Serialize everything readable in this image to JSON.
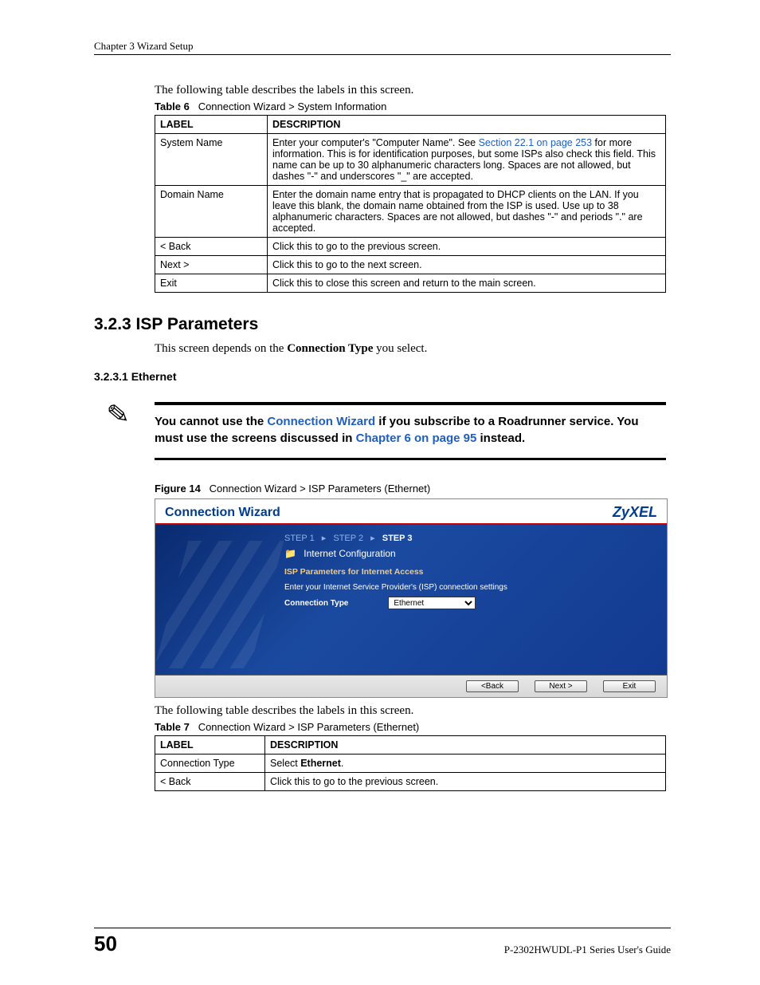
{
  "running_head": "Chapter 3 Wizard Setup",
  "intro1": "The following table describes the labels in this screen.",
  "table6": {
    "caption_bold": "Table 6",
    "caption_rest": "Connection Wizard > System Information",
    "headers": {
      "c1": "LABEL",
      "c2": "DESCRIPTION"
    },
    "rows": {
      "r1": {
        "label": "System Name",
        "desc_before": "Enter your computer's \"Computer Name\". See ",
        "desc_link": "Section 22.1 on page 253",
        "desc_after": " for more information. This is for identification purposes, but some ISPs also check this field. This name can be up to 30 alphanumeric characters long. Spaces are not allowed, but dashes \"-\" and underscores \"_\" are accepted."
      },
      "r2": {
        "label": "Domain Name",
        "desc": "Enter the domain name entry that is propagated to DHCP clients on the LAN. If you leave this blank, the domain name obtained from the ISP is used. Use up to 38 alphanumeric characters. Spaces are not allowed, but dashes \"-\" and periods \".\" are accepted."
      },
      "r3": {
        "label": "< Back",
        "desc": "Click this to go to the previous screen."
      },
      "r4": {
        "label": "Next >",
        "desc": "Click this to go to the next screen."
      },
      "r5": {
        "label": "Exit",
        "desc": "Click this to close this screen and return to the main screen."
      }
    }
  },
  "sect_3_2_3": "3.2.3  ISP Parameters",
  "para_3_2_3_a": "This screen depends on the ",
  "para_3_2_3_b": "Connection Type",
  "para_3_2_3_c": " you select.",
  "subsect_3_2_3_1": "3.2.3.1  Ethernet",
  "note": {
    "t1": "You cannot use the ",
    "link1": "Connection Wizard",
    "t2": " if you subscribe to a Roadrunner service. You must use the screens discussed in ",
    "link2": "Chapter 6 on page 95",
    "t3": " instead."
  },
  "figure14": {
    "caption_bold": "Figure 14",
    "caption_rest": "Connection Wizard > ISP Parameters (Ethernet)"
  },
  "wizard": {
    "title": "Connection Wizard",
    "brand": "ZyXEL",
    "step1": "STEP 1",
    "step2": "STEP 2",
    "step3": "STEP 3",
    "section_header": "Internet Configuration",
    "sub_header": "ISP Parameters for Internet Access",
    "message": "Enter your Internet Service Provider's (ISP) connection settings",
    "ct_label": "Connection Type",
    "ct_value": "Ethernet",
    "btn_back": "<Back",
    "btn_next": "Next >",
    "btn_exit": "Exit"
  },
  "intro2": "The following table describes the labels in this screen.",
  "table7": {
    "caption_bold": "Table 7",
    "caption_rest": "Connection Wizard > ISP Parameters (Ethernet)",
    "headers": {
      "c1": "LABEL",
      "c2": "DESCRIPTION"
    },
    "rows": {
      "r1": {
        "label": "Connection Type",
        "desc_a": "Select ",
        "desc_b": "Ethernet",
        "desc_c": "."
      },
      "r2": {
        "label": "< Back",
        "desc": "Click this to go to the previous screen."
      }
    }
  },
  "footer": {
    "page": "50",
    "guide": "P-2302HWUDL-P1 Series User's Guide"
  }
}
